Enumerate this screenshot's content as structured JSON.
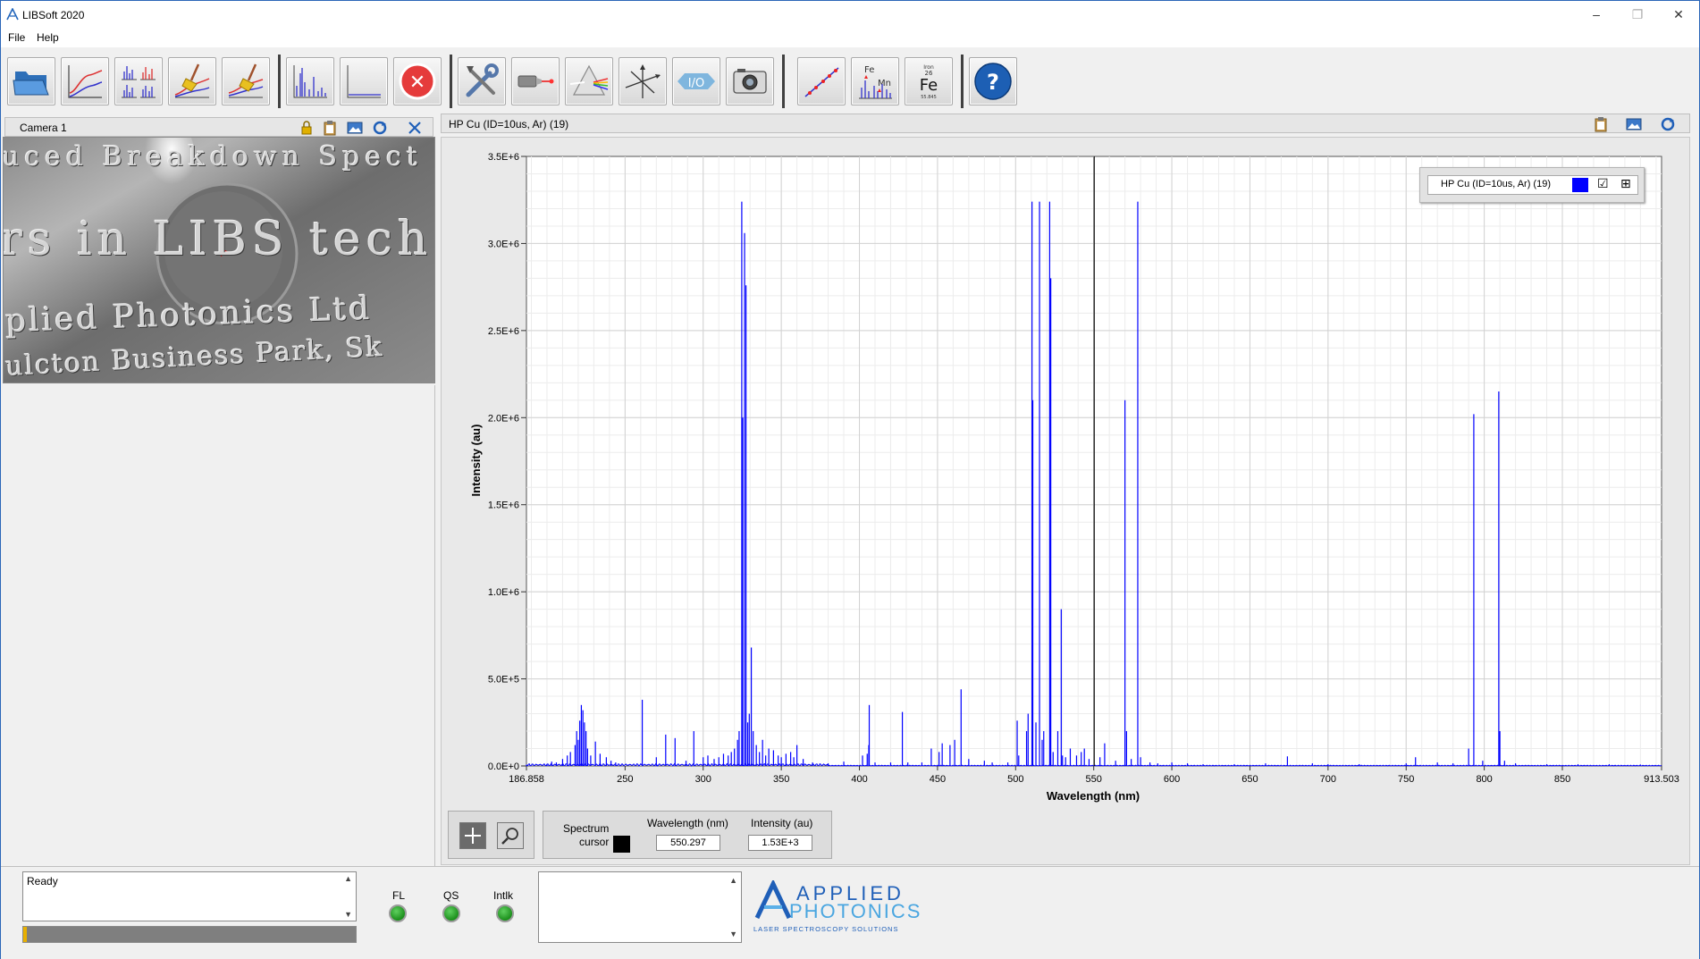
{
  "window": {
    "title": "LIBSoft 2020",
    "minimize": "–",
    "restore": "❐",
    "close": "✕"
  },
  "menu": {
    "items": [
      "File",
      "Help"
    ]
  },
  "toolbar": {
    "groups": [
      [
        "open-folder",
        "spectrum-view",
        "multi-spectra",
        "clean-spectrum",
        "clean-all"
      ],
      [
        "acquire-spectrum",
        "background",
        "stop"
      ],
      [
        "settings",
        "laser",
        "spectrometer",
        "stage-axes",
        "io",
        "camera"
      ],
      [
        "calibration",
        "element-lines",
        "periodic-table"
      ],
      [
        "help"
      ]
    ],
    "periodic": {
      "number": "26",
      "name": "Iron",
      "symbol": "Fe",
      "mass": "55.845"
    },
    "element_icon": {
      "a": "Fe",
      "b": "Mn"
    },
    "stop_glyph": "✕",
    "io_label": "I/O",
    "help_glyph": "?"
  },
  "camera_panel": {
    "title": "Camera 1",
    "lines": [
      "uced Breakdown Spect",
      "rs in LIBS tech",
      "plied Photonics Ltd",
      "ulcton Business Park, Sk"
    ]
  },
  "plot_panel": {
    "title": "HP Cu (ID=10us, Ar) (19)",
    "legend": {
      "label": "HP Cu (ID=10us, Ar) (19)",
      "color": "#0000ff",
      "check": "☑",
      "expand": "⊞"
    }
  },
  "chart_data": {
    "type": "line",
    "xlabel": "Wavelength (nm)",
    "ylabel": "Intensity (au)",
    "xlim": [
      186.858,
      913.503
    ],
    "ylim": [
      0,
      3500000
    ],
    "x_ticks": [
      186.858,
      250,
      300,
      350,
      400,
      450,
      500,
      550,
      600,
      650,
      700,
      750,
      800,
      850,
      913.503
    ],
    "x_tick_labels": [
      "186.858",
      "250",
      "300",
      "350",
      "400",
      "450",
      "500",
      "550",
      "600",
      "650",
      "700",
      "750",
      "800",
      "850",
      "913.503"
    ],
    "y_ticks": [
      0,
      500000,
      1000000,
      1500000,
      2000000,
      2500000,
      3000000,
      3500000
    ],
    "y_tick_labels": [
      "0.0E+0",
      "5.0E+5",
      "1.0E+6",
      "1.5E+6",
      "2.0E+6",
      "2.5E+6",
      "3.0E+6",
      "3.5E+6"
    ],
    "grid": true,
    "cursor_x": 550.297,
    "series": [
      {
        "name": "HP Cu (ID=10us, Ar) (19)",
        "color": "#0000ff",
        "peaks": [
          [
            200,
            10000
          ],
          [
            203,
            25000
          ],
          [
            206,
            20000
          ],
          [
            210,
            40000
          ],
          [
            213,
            60000
          ],
          [
            215,
            80000
          ],
          [
            218,
            120000
          ],
          [
            219,
            200000
          ],
          [
            220,
            150000
          ],
          [
            221,
            260000
          ],
          [
            222,
            350000
          ],
          [
            223,
            320000
          ],
          [
            224,
            250000
          ],
          [
            225,
            200000
          ],
          [
            226,
            100000
          ],
          [
            228,
            60000
          ],
          [
            231,
            140000
          ],
          [
            234,
            70000
          ],
          [
            238,
            50000
          ],
          [
            241,
            30000
          ],
          [
            244,
            20000
          ],
          [
            261,
            380000
          ],
          [
            270,
            50000
          ],
          [
            276,
            180000
          ],
          [
            282,
            160000
          ],
          [
            289,
            30000
          ],
          [
            294,
            200000
          ],
          [
            300,
            50000
          ],
          [
            303,
            60000
          ],
          [
            307,
            40000
          ],
          [
            310,
            50000
          ],
          [
            313,
            70000
          ],
          [
            316,
            60000
          ],
          [
            318,
            80000
          ],
          [
            320,
            100000
          ],
          [
            322,
            150000
          ],
          [
            323,
            200000
          ],
          [
            324.7,
            3240000
          ],
          [
            325.3,
            2000000
          ],
          [
            326.5,
            3060000
          ],
          [
            327.4,
            2760000
          ],
          [
            328.5,
            250000
          ],
          [
            329.5,
            300000
          ],
          [
            330.8,
            680000
          ],
          [
            332,
            200000
          ],
          [
            334,
            120000
          ],
          [
            336,
            80000
          ],
          [
            338,
            150000
          ],
          [
            340,
            60000
          ],
          [
            342,
            100000
          ],
          [
            345,
            90000
          ],
          [
            348,
            60000
          ],
          [
            350,
            50000
          ],
          [
            353,
            70000
          ],
          [
            356,
            80000
          ],
          [
            358,
            50000
          ],
          [
            360,
            120000
          ],
          [
            364,
            40000
          ],
          [
            370,
            20000
          ],
          [
            380,
            15000
          ],
          [
            390,
            25000
          ],
          [
            402,
            60000
          ],
          [
            405,
            70000
          ],
          [
            406,
            120000
          ],
          [
            406.3,
            350000
          ],
          [
            410,
            20000
          ],
          [
            420,
            20000
          ],
          [
            427.5,
            310000
          ],
          [
            431,
            20000
          ],
          [
            440,
            20000
          ],
          [
            446,
            100000
          ],
          [
            451,
            80000
          ],
          [
            453,
            130000
          ],
          [
            458,
            120000
          ],
          [
            461,
            150000
          ],
          [
            465.1,
            440000
          ],
          [
            470,
            40000
          ],
          [
            480,
            30000
          ],
          [
            485,
            20000
          ],
          [
            495,
            20000
          ],
          [
            501,
            260000
          ],
          [
            502,
            60000
          ],
          [
            507,
            200000
          ],
          [
            508,
            300000
          ],
          [
            510.5,
            3240000
          ],
          [
            511,
            2100000
          ],
          [
            513,
            250000
          ],
          [
            515.3,
            3240000
          ],
          [
            517,
            150000
          ],
          [
            518,
            200000
          ],
          [
            521.8,
            3240000
          ],
          [
            522.5,
            2800000
          ],
          [
            524,
            80000
          ],
          [
            527,
            200000
          ],
          [
            529.2,
            900000
          ],
          [
            530,
            60000
          ],
          [
            532,
            50000
          ],
          [
            535,
            100000
          ],
          [
            539,
            60000
          ],
          [
            542,
            80000
          ],
          [
            544,
            100000
          ],
          [
            547,
            40000
          ],
          [
            554,
            50000
          ],
          [
            557,
            130000
          ],
          [
            564,
            30000
          ],
          [
            570.0,
            2100000
          ],
          [
            571,
            200000
          ],
          [
            574,
            40000
          ],
          [
            578.2,
            3240000
          ],
          [
            580,
            50000
          ],
          [
            586,
            20000
          ],
          [
            591,
            15000
          ],
          [
            600,
            20000
          ],
          [
            610,
            15000
          ],
          [
            620,
            10000
          ],
          [
            640,
            10000
          ],
          [
            660,
            15000
          ],
          [
            674,
            55000
          ],
          [
            690,
            15000
          ],
          [
            700,
            10000
          ],
          [
            720,
            10000
          ],
          [
            750,
            15000
          ],
          [
            756,
            50000
          ],
          [
            770,
            20000
          ],
          [
            780,
            15000
          ],
          [
            790,
            100000
          ],
          [
            793.3,
            2020000
          ],
          [
            799,
            30000
          ],
          [
            809.3,
            2150000
          ],
          [
            810,
            200000
          ],
          [
            813,
            30000
          ],
          [
            820,
            15000
          ],
          [
            840,
            10000
          ],
          [
            860,
            10000
          ],
          [
            880,
            10000
          ],
          [
            900,
            8000
          ]
        ]
      }
    ]
  },
  "cursor_panel": {
    "label_line1": "Spectrum",
    "label_line2": "cursor",
    "wavelength_header": "Wavelength (nm)",
    "intensity_header": "Intensity (au)",
    "wavelength_value": "550.297",
    "intensity_value": "1.53E+3"
  },
  "status": {
    "text": "Ready",
    "progress": 0.01,
    "leds": [
      {
        "label": "FL",
        "color": "#1c8f1c"
      },
      {
        "label": "QS",
        "color": "#1c8f1c"
      },
      {
        "label": "Intlk",
        "color": "#1c8f1c"
      }
    ]
  },
  "brand": {
    "line1": "APPLIED",
    "line2": "PHOTONICS",
    "tagline": "LASER SPECTROSCOPY SOLUTIONS"
  }
}
